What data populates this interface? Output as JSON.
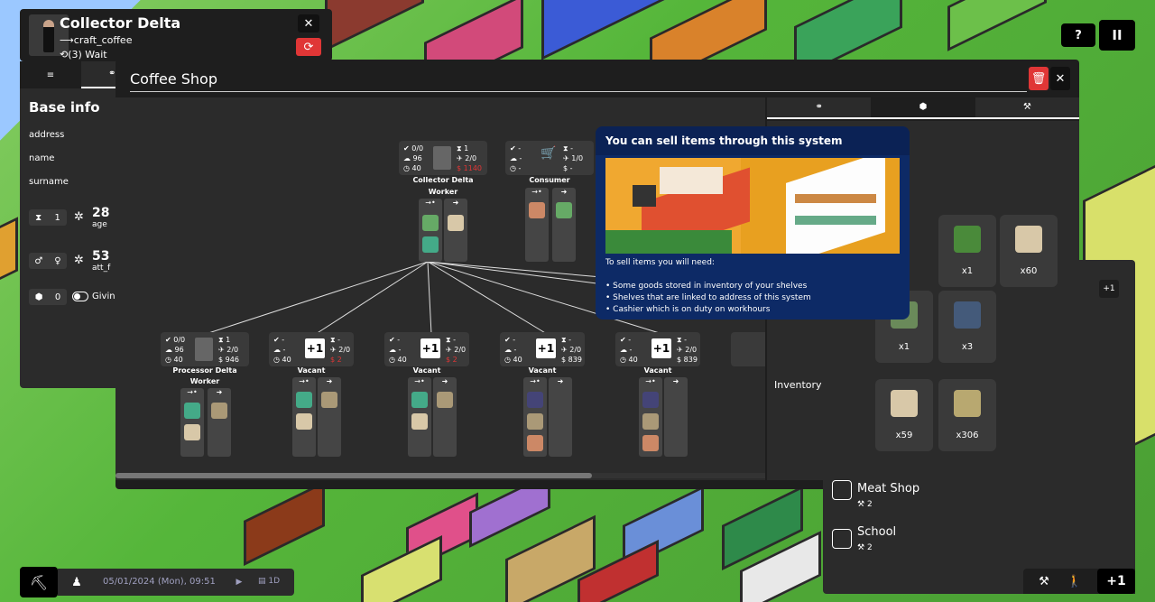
{
  "agent": {
    "name": "Collector Delta",
    "task": "⟶craft_coffee",
    "state": "⟲(3) Wait"
  },
  "top_right": {
    "help": "?",
    "pause": "II"
  },
  "base_info": {
    "title": "Base info",
    "fields": [
      "address",
      "name",
      "surname"
    ],
    "level": "1",
    "age_value": "28",
    "age_label": "age",
    "attr_value": "53",
    "attr_label": "att_f",
    "toggle_value": "0",
    "toggle_label": "Giving"
  },
  "shop": {
    "title": "Coffee Shop"
  },
  "nodes": {
    "top": [
      {
        "stats": [
          "0/0",
          "96",
          "40"
        ],
        "right": [
          "1",
          "2/0",
          "1140"
        ],
        "name": "Collector Delta",
        "role": "Worker"
      },
      {
        "stats": [
          "-",
          "-",
          "-"
        ],
        "right": [
          "-",
          "1/0",
          "-"
        ],
        "name": "Consumer",
        "role": ""
      }
    ],
    "bottom": [
      {
        "stats": [
          "0/0",
          "96",
          "40"
        ],
        "right": [
          "1",
          "2/0",
          "946"
        ],
        "name": "Processor Delta",
        "role": "Worker",
        "plus": ""
      },
      {
        "stats": [
          "-",
          "-",
          "40"
        ],
        "right": [
          "-",
          "2/0",
          "2"
        ],
        "name": "Vacant",
        "role": "",
        "plus": "+1"
      },
      {
        "stats": [
          "-",
          "-",
          "40"
        ],
        "right": [
          "-",
          "2/0",
          "2"
        ],
        "name": "Vacant",
        "role": "",
        "plus": "+1"
      },
      {
        "stats": [
          "-",
          "-",
          "40"
        ],
        "right": [
          "-",
          "2/0",
          "839"
        ],
        "name": "Vacant",
        "role": "",
        "plus": "+1"
      },
      {
        "stats": [
          "-",
          "-",
          "40"
        ],
        "right": [
          "-",
          "2/0",
          "839"
        ],
        "name": "Vacant",
        "role": "",
        "plus": "+1"
      }
    ]
  },
  "tooltip": {
    "title": "You can sell items through this system",
    "lead": "To sell items you will need:",
    "bullets": [
      "• Some goods stored in inventory of your shelves",
      "• Shelves that are linked to address of this system",
      "• Cashier which is on duty on workhours"
    ]
  },
  "items": {
    "row1": [
      {
        "icon": "tree-icon",
        "qty": "x1"
      },
      {
        "icon": "sack-icon",
        "qty": "x60"
      }
    ],
    "row2": [
      {
        "icon": "crate-icon",
        "qty": "x1"
      },
      {
        "icon": "register-icon",
        "qty": "x3"
      }
    ],
    "inventory_label": "Inventory",
    "inventory": [
      {
        "icon": "sack-icon",
        "qty": "x59"
      },
      {
        "icon": "box-icon",
        "qty": "x306"
      }
    ]
  },
  "right_list": {
    "plus_small": "+1",
    "entries": [
      {
        "name": "Meat Shop",
        "count": "2"
      },
      {
        "name": "School",
        "count": "2"
      }
    ],
    "plus": "+1"
  },
  "bottom_bar": {
    "datetime": "05/01/2024 (Mon), 09:51",
    "speed": "1D"
  },
  "colors": {
    "accent_red": "#e03636",
    "tooltip_bg": "#0d2a66",
    "tooltip_header": "#0b2255"
  }
}
